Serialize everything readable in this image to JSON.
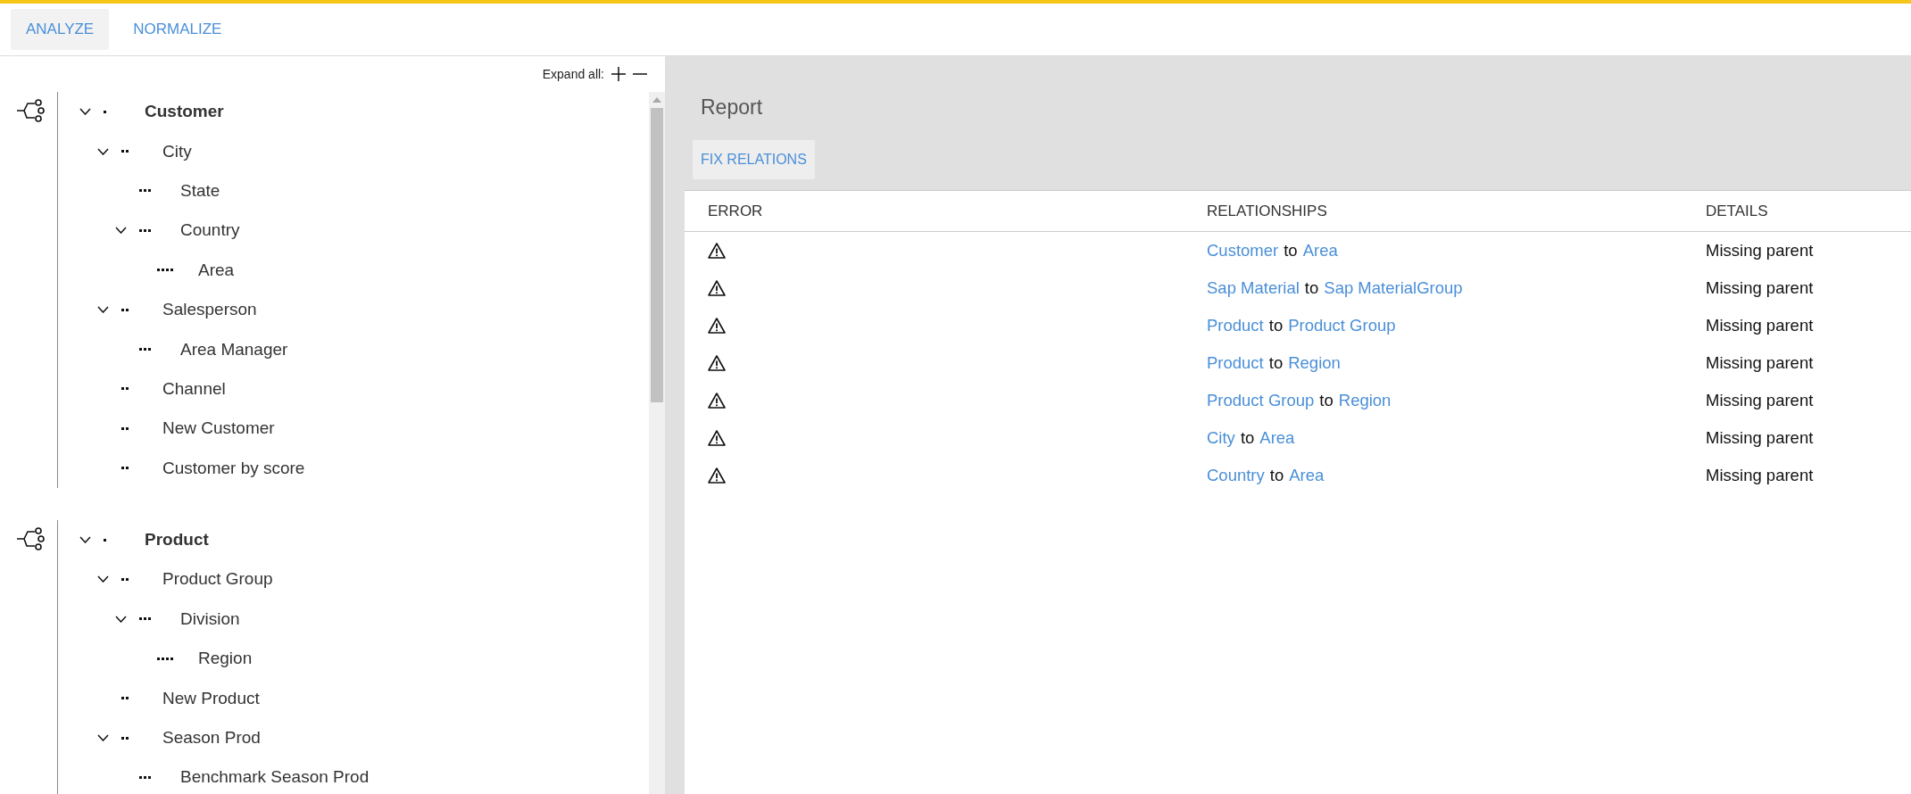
{
  "tabs": [
    {
      "label": "ANALYZE",
      "selected": true
    },
    {
      "label": "NORMALIZE",
      "selected": false
    }
  ],
  "tree": {
    "expand_all_label": "Expand all:",
    "groups": [
      {
        "label": "Customer",
        "expanded": true,
        "children": [
          {
            "label": "City",
            "expanded": true,
            "children": [
              {
                "label": "State"
              },
              {
                "label": "Country",
                "expanded": true,
                "children": [
                  {
                    "label": "Area"
                  }
                ]
              }
            ]
          },
          {
            "label": "Salesperson",
            "expanded": true,
            "children": [
              {
                "label": "Area Manager"
              }
            ]
          },
          {
            "label": "Channel"
          },
          {
            "label": "New Customer"
          },
          {
            "label": "Customer by score"
          }
        ]
      },
      {
        "label": "Product",
        "expanded": true,
        "children": [
          {
            "label": "Product Group",
            "expanded": true,
            "children": [
              {
                "label": "Division",
                "expanded": true,
                "children": [
                  {
                    "label": "Region"
                  }
                ]
              }
            ]
          },
          {
            "label": "New Product"
          },
          {
            "label": "Season Prod",
            "expanded": true,
            "children": [
              {
                "label": "Benchmark Season Prod"
              }
            ]
          }
        ]
      }
    ]
  },
  "report": {
    "title": "Report",
    "fix_button": "FIX RELATIONS",
    "columns": [
      "ERROR",
      "RELATIONSHIPS",
      "DETAILS"
    ],
    "rows": [
      {
        "relationship": {
          "from": "Customer",
          "connector": "to",
          "to": "Area"
        },
        "details": "Missing parent"
      },
      {
        "relationship": {
          "from": "Sap Material",
          "connector": "to",
          "to": "Sap MaterialGroup"
        },
        "details": "Missing parent"
      },
      {
        "relationship": {
          "from": "Product",
          "connector": "to",
          "to": "Product Group"
        },
        "details": "Missing parent"
      },
      {
        "relationship": {
          "from": "Product",
          "connector": "to",
          "to": "Region"
        },
        "details": "Missing parent"
      },
      {
        "relationship": {
          "from": "Product Group",
          "connector": "to",
          "to": "Region"
        },
        "details": "Missing parent"
      },
      {
        "relationship": {
          "from": "City",
          "connector": "to",
          "to": "Area"
        },
        "details": "Missing parent"
      },
      {
        "relationship": {
          "from": "Country",
          "connector": "to",
          "to": "Area"
        },
        "details": "Missing parent"
      }
    ]
  }
}
